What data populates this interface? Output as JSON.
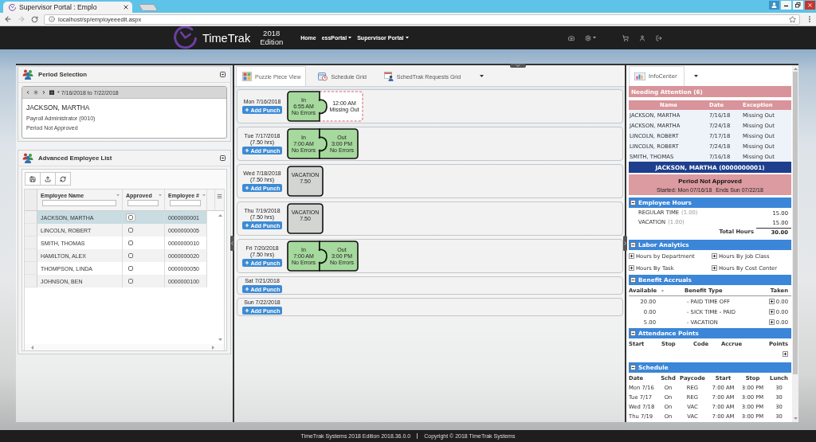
{
  "browser": {
    "tab_title": "Supervisor Portal : Emplo",
    "address": "localhost/sp/employeeedit.aspx"
  },
  "navbar": {
    "brand": "TimeTrak",
    "edition_year": "2018",
    "edition_label": "Edition",
    "links": [
      {
        "label": "Home",
        "dropdown": false
      },
      {
        "label": "essPortal",
        "dropdown": true
      },
      {
        "label": "Supervisor Portal",
        "dropdown": true
      }
    ]
  },
  "period_selection": {
    "title": "Period Selection",
    "date_range": "* 7/16/2018 to 7/22/2018",
    "employee_name": "JACKSON, MARTHA",
    "position": "Payroll Administrator (0010)",
    "status": "Period Not Approved"
  },
  "employee_list": {
    "title": "Advanced Employee List",
    "columns": [
      "Employee Name",
      "Approved",
      "Employee #"
    ],
    "rows": [
      {
        "name": "JACKSON, MARTHA",
        "approved": false,
        "number": "0000000001",
        "selected": true
      },
      {
        "name": "LINCOLN, ROBERT",
        "approved": false,
        "number": "0000000005",
        "selected": false
      },
      {
        "name": "SMITH, THOMAS",
        "approved": false,
        "number": "0000000010",
        "selected": false
      },
      {
        "name": "HAMILTON, ALEX",
        "approved": false,
        "number": "0000000020",
        "selected": false
      },
      {
        "name": "THOMPSON, LINDA",
        "approved": false,
        "number": "0000000050",
        "selected": false
      },
      {
        "name": "JOHNSON, BEN",
        "approved": false,
        "number": "0000000100",
        "selected": false
      }
    ]
  },
  "view_tabs": [
    {
      "label": "Puzzle Piece View",
      "selected": true
    },
    {
      "label": "Schedule Grid",
      "selected": false
    },
    {
      "label": "SchedTrak Requests Grid",
      "selected": false
    }
  ],
  "days": [
    {
      "date": "Mon 7/16/2018",
      "button": "Add Punch",
      "pieces": [
        {
          "kind": "punch",
          "label": "In",
          "time": "6:55 AM",
          "status": "No Errors"
        },
        {
          "kind": "missing",
          "time": "12:00 AM",
          "status": "Missing Out"
        }
      ]
    },
    {
      "date": "Tue 7/17/2018",
      "hours": "(7.50 hrs)",
      "button": "Add Punch",
      "pieces": [
        {
          "kind": "punch",
          "label": "In",
          "time": "7:00 AM",
          "status": "No Errors"
        },
        {
          "kind": "punch",
          "label": "Out",
          "time": "3:00 PM",
          "status": "No Errors"
        }
      ]
    },
    {
      "date": "Wed 7/18/2018",
      "hours": "(7.50 hrs)",
      "button": "Add Punch",
      "pieces": [
        {
          "kind": "vacation",
          "label": "VACATION",
          "time": "7.50"
        }
      ]
    },
    {
      "date": "Thu 7/19/2018",
      "hours": "(7.50 hrs)",
      "button": "Add Punch",
      "pieces": [
        {
          "kind": "vacation",
          "label": "VACATION",
          "time": "7.50"
        }
      ]
    },
    {
      "date": "Fri 7/20/2018",
      "hours": "(7.50 hrs)",
      "button": "Add Punch",
      "pieces": [
        {
          "kind": "punch",
          "label": "In",
          "time": "7:00 AM",
          "status": "No Errors"
        },
        {
          "kind": "punch",
          "label": "Out",
          "time": "3:00 PM",
          "status": "No Errors"
        }
      ]
    },
    {
      "date": "Sat 7/21/2018",
      "button": "Add Punch"
    },
    {
      "date": "Sun 7/22/2018",
      "button": "Add Punch"
    }
  ],
  "info_center": {
    "tabs": [
      {
        "label": "InfoCenter",
        "selected": true
      }
    ],
    "needing_attention": {
      "title": "Needing Attention (6)",
      "columns": [
        "Name",
        "Date",
        "Exception"
      ],
      "rows": [
        {
          "name": "JACKSON, MARTHA",
          "date": "7/16/18",
          "exception": "Missing Out"
        },
        {
          "name": "JACKSON, MARTHA",
          "date": "7/24/18",
          "exception": "Missing Out"
        },
        {
          "name": "LINCOLN, ROBERT",
          "date": "7/17/18",
          "exception": "Missing Out"
        },
        {
          "name": "LINCOLN, ROBERT",
          "date": "7/24/18",
          "exception": "Missing Out"
        },
        {
          "name": "SMITH, THOMAS",
          "date": "7/16/18",
          "exception": "Missing Out"
        }
      ]
    },
    "employee_banner": "JACKSON, MARTHA (0000000001)",
    "period_status": {
      "title": "Period Not Approved",
      "started": "Started: Mon 07/16/18",
      "ends": "Ends Sun 07/22/18"
    },
    "sections": [
      {
        "kind": "hours",
        "title": "Employee Hours",
        "expanded": true,
        "rows": [
          {
            "label": "REGULAR TIME",
            "factor": "(1.00)",
            "value": "15.00"
          },
          {
            "label": "VACATION",
            "factor": "(1.00)",
            "value": "15.00"
          }
        ],
        "total_label": "Total Hours",
        "total": "30.00"
      },
      {
        "kind": "links",
        "title": "Labor Analytics",
        "expanded": true,
        "links": [
          {
            "label": "Hours by Department",
            "expanded": false
          },
          {
            "label": "Hours By Job Class",
            "expanded": false
          },
          {
            "label": "Hours By Task",
            "expanded": false
          },
          {
            "label": "Hours By Cost Center",
            "expanded": false
          }
        ]
      },
      {
        "kind": "accruals",
        "title": "Benefit Accruals",
        "expanded": true,
        "columns": [
          "Available",
          "-",
          "Benefit Type",
          "Taken"
        ],
        "rows": [
          {
            "available": "20.00",
            "type": "- PAID TIME OFF",
            "taken": "0.00",
            "expanded": false
          },
          {
            "available": "0.00",
            "type": "- SICK TIME - PAID",
            "taken": "0.00",
            "expanded": false
          },
          {
            "available": "5.00",
            "type": "- VACATION",
            "taken": "0.00",
            "expanded": false
          }
        ]
      },
      {
        "kind": "points",
        "title": "Attendance Points",
        "expanded": true,
        "columns": [
          "Start",
          "Stop",
          "Code",
          "Accrue",
          "Points"
        ]
      },
      {
        "kind": "schedule",
        "title": "Schedule",
        "expanded": true,
        "columns": [
          "Date",
          "Schd",
          "Paycode",
          "Start",
          "Stop",
          "Lunch"
        ],
        "rows": [
          [
            "Mon 7/16",
            "On",
            "REG",
            "7:00 AM",
            "3:00 PM",
            "30"
          ],
          [
            "Tue 7/17",
            "On",
            "REG",
            "7:00 AM",
            "3:00 PM",
            "30"
          ],
          [
            "Wed 7/18",
            "On",
            "VAC",
            "7:00 AM",
            "3:00 PM",
            "30"
          ],
          [
            "Thu 7/19",
            "On",
            "VAC",
            "7:00 AM",
            "3:00 PM",
            "30"
          ]
        ]
      }
    ]
  },
  "footer": {
    "version": "TimeTrak Systems 2018 Edition 2018.36.0.0",
    "copyright": "Copyright © 2018 TimeTrak Systems"
  }
}
